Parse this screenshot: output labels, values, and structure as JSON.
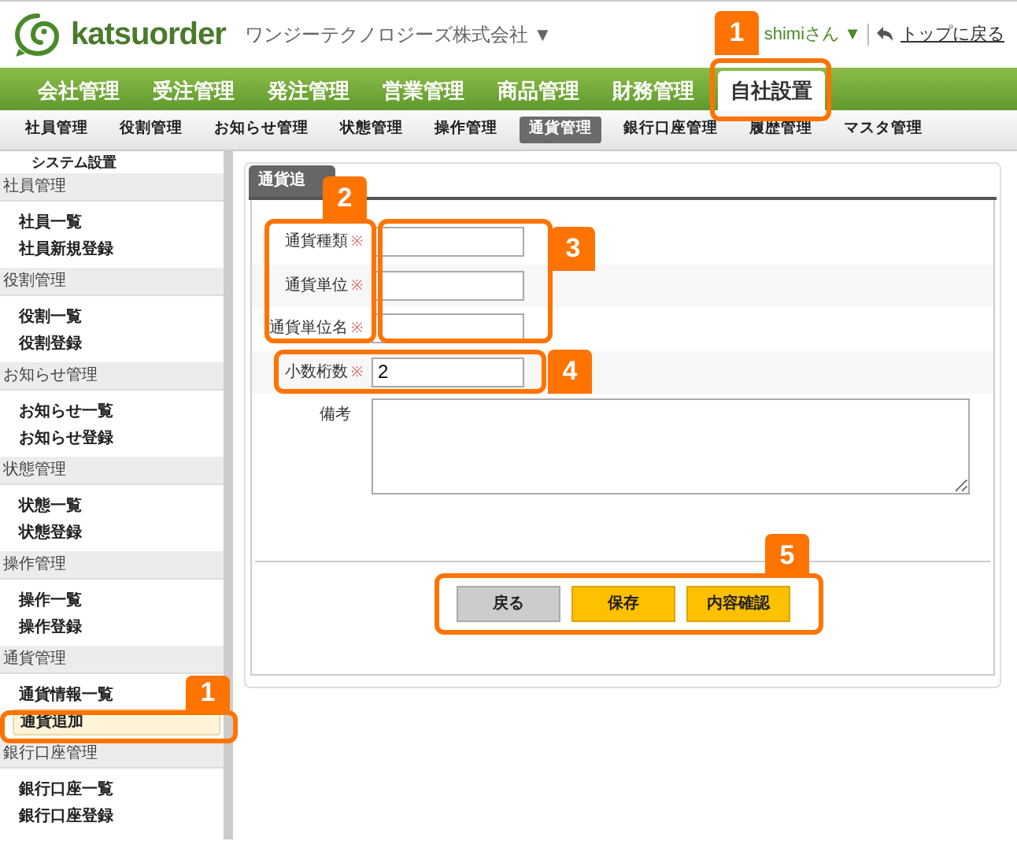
{
  "header": {
    "logo_text": "katsuorder",
    "company": "ワンジーテクノロジーズ株式会社 ▼",
    "user": "shimiさん ▼",
    "top_link": "トップに戻る"
  },
  "main_nav": [
    {
      "label": "会社管理",
      "selected": false
    },
    {
      "label": "受注管理",
      "selected": false
    },
    {
      "label": "発注管理",
      "selected": false
    },
    {
      "label": "営業管理",
      "selected": false
    },
    {
      "label": "商品管理",
      "selected": false
    },
    {
      "label": "財務管理",
      "selected": false
    },
    {
      "label": "自社設置",
      "selected": true
    }
  ],
  "sub_nav": [
    {
      "label": "社員管理",
      "selected": false
    },
    {
      "label": "役割管理",
      "selected": false
    },
    {
      "label": "お知らせ管理",
      "selected": false
    },
    {
      "label": "状態管理",
      "selected": false
    },
    {
      "label": "操作管理",
      "selected": false
    },
    {
      "label": "通貨管理",
      "selected": true
    },
    {
      "label": "銀行口座管理",
      "selected": false
    },
    {
      "label": "履歴管理",
      "selected": false
    },
    {
      "label": "マスタ管理",
      "selected": false
    }
  ],
  "sidebar": {
    "title": "システム設置",
    "groups": [
      {
        "label": "社員管理",
        "items": [
          {
            "label": "社員一覧",
            "selected": false
          },
          {
            "label": "社員新規登録",
            "selected": false
          }
        ]
      },
      {
        "label": "役割管理",
        "items": [
          {
            "label": "役割一覧",
            "selected": false
          },
          {
            "label": "役割登録",
            "selected": false
          }
        ]
      },
      {
        "label": "お知らせ管理",
        "items": [
          {
            "label": "お知らせ一覧",
            "selected": false
          },
          {
            "label": "お知らせ登録",
            "selected": false
          }
        ]
      },
      {
        "label": "状態管理",
        "items": [
          {
            "label": "状態一覧",
            "selected": false
          },
          {
            "label": "状態登録",
            "selected": false
          }
        ]
      },
      {
        "label": "操作管理",
        "items": [
          {
            "label": "操作一覧",
            "selected": false
          },
          {
            "label": "操作登録",
            "selected": false
          }
        ]
      },
      {
        "label": "通貨管理",
        "items": [
          {
            "label": "通貨情報一覧",
            "selected": false
          },
          {
            "label": "通貨追加",
            "selected": true
          }
        ]
      },
      {
        "label": "銀行口座管理",
        "items": [
          {
            "label": "銀行口座一覧",
            "selected": false
          },
          {
            "label": "銀行口座登録",
            "selected": false
          }
        ]
      }
    ]
  },
  "form": {
    "tab": "通貨追",
    "fields": [
      {
        "label": "通貨種類",
        "required_mark": "※"
      },
      {
        "label": "通貨単位",
        "required_mark": "※"
      },
      {
        "label": "通貨単位名",
        "required_mark": "※"
      },
      {
        "label": "小数桁数",
        "required_mark": "※",
        "value": "2"
      }
    ],
    "notes": {
      "label": "備考"
    },
    "buttons": [
      {
        "label": "戻る",
        "kind": "secondary"
      },
      {
        "label": "保存",
        "kind": "primary"
      },
      {
        "label": "内容確認",
        "kind": "primary"
      }
    ]
  },
  "annotations": [
    {
      "number": "1"
    },
    {
      "number": "2"
    },
    {
      "number": "3"
    },
    {
      "number": "4"
    },
    {
      "number": "5"
    },
    {
      "number": "1"
    }
  ]
}
